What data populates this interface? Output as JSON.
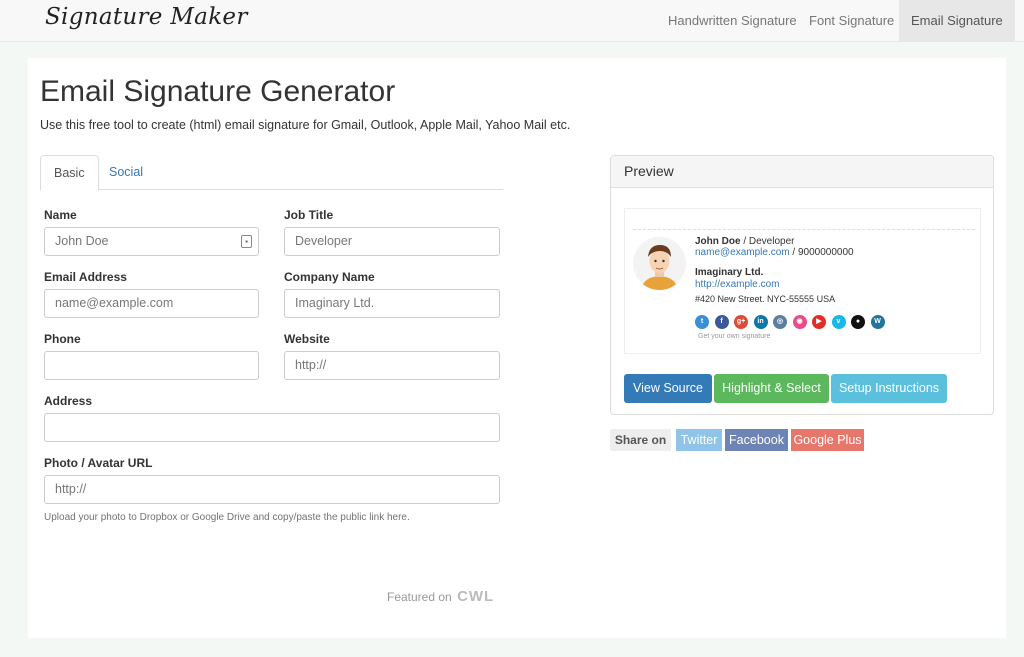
{
  "navbar": {
    "brand": "Signature Maker",
    "links": [
      "Handwritten Signature",
      "Font Signature",
      "Email Signature"
    ],
    "active_index": 2
  },
  "page": {
    "title": "Email Signature Generator",
    "lead": "Use this free tool to create (html) email signature for Gmail, Outlook, Apple Mail, Yahoo Mail etc."
  },
  "tabs": [
    "Basic",
    "Social"
  ],
  "form": {
    "name": {
      "label": "Name",
      "value": "",
      "placeholder": "John Doe"
    },
    "job_title": {
      "label": "Job Title",
      "value": "",
      "placeholder": "Developer"
    },
    "email": {
      "label": "Email Address",
      "value": "",
      "placeholder": "name@example.com"
    },
    "company": {
      "label": "Company Name",
      "value": "",
      "placeholder": "Imaginary Ltd."
    },
    "phone": {
      "label": "Phone",
      "value": "",
      "placeholder": ""
    },
    "website": {
      "label": "Website",
      "value": "",
      "placeholder": "http://"
    },
    "address": {
      "label": "Address",
      "value": "",
      "placeholder": ""
    },
    "photo": {
      "label": "Photo / Avatar URL",
      "value": "",
      "placeholder": "http://"
    },
    "photo_help": "Upload your photo to Dropbox or Google Drive and copy/paste the public link here."
  },
  "featured": {
    "prefix": "Featured on",
    "brand": "CWL"
  },
  "preview": {
    "heading": "Preview",
    "signature": {
      "name": "John Doe",
      "title_sep": " / Developer",
      "email": "name@example.com",
      "phone_sep": " / 9000000000",
      "company": "Imaginary Ltd.",
      "website": "http://example.com",
      "address": "#420 New Street. NYC-55555 USA",
      "own_link": "Get your own signature"
    },
    "social_icons": [
      {
        "icon": "twitter-icon",
        "glyph": "t",
        "color": "#3a8fd6"
      },
      {
        "icon": "facebook-icon",
        "glyph": "f",
        "color": "#3b5998"
      },
      {
        "icon": "google-plus-icon",
        "glyph": "g+",
        "color": "#dd4b39"
      },
      {
        "icon": "linkedin-icon",
        "glyph": "in",
        "color": "#0e76a8"
      },
      {
        "icon": "instagram-icon",
        "glyph": "◎",
        "color": "#5a7fa0"
      },
      {
        "icon": "dribbble-icon",
        "glyph": "◉",
        "color": "#ea4c89"
      },
      {
        "icon": "youtube-icon",
        "glyph": "▶",
        "color": "#e52d27"
      },
      {
        "icon": "vimeo-icon",
        "glyph": "v",
        "color": "#1ab7ea"
      },
      {
        "icon": "github-icon",
        "glyph": "●",
        "color": "#111111"
      },
      {
        "icon": "wordpress-icon",
        "glyph": "W",
        "color": "#21759b"
      }
    ],
    "buttons": {
      "view_source": "View Source",
      "highlight": "Highlight & Select",
      "instructions": "Setup Instructions"
    }
  },
  "share": {
    "label": "Share on",
    "twitter": "Twitter",
    "facebook": "Facebook",
    "google_plus": "Google Plus"
  },
  "colors": {
    "primary": "#337ab7",
    "success": "#5cb85c",
    "info": "#5bc0de",
    "twitter": "#8fc3e8",
    "facebook": "#6d84b4",
    "google_plus": "#e7776a"
  }
}
